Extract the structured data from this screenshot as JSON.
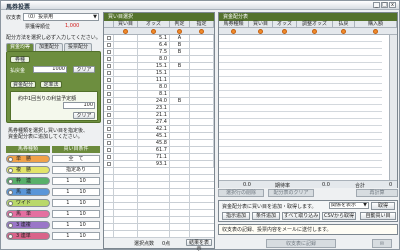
{
  "window": {
    "title": "馬券投票",
    "min_label": "_",
    "max_label": "□",
    "close_label": "x"
  },
  "left": {
    "race_label": "収支表",
    "race_value": "（0）投票用",
    "sub_label": "票獲得順位",
    "sub_value": "1,000",
    "instruction": "配分方法を選択し必ず入力してください。",
    "tabs": [
      "資金均等",
      "加重配分",
      "投票配分"
    ],
    "green": {
      "bet_type_label": "券種",
      "amount_label": "払戻金",
      "amount_value": "1000",
      "clear_label": "クリア",
      "mode_label": "資金配分",
      "mode_value": "定率法",
      "range_text": "約中1回当りの利益予定額",
      "range_value": "100",
      "clear2_label": "クリア"
    },
    "note_lines": [
      "馬券種類を選択し買い目を指定後、",
      "資金配分表に追加してください。"
    ],
    "table_head": [
      "馬券種類",
      "買い目条件"
    ],
    "bets": [
      {
        "name": "単　勝",
        "cond": "全　て",
        "color": "#f1a24a"
      },
      {
        "name": "複　勝",
        "cond": "指定あり",
        "color": "#e2e46a"
      },
      {
        "name": "枠　連",
        "cond": "1　　10",
        "color": "#58b06a"
      },
      {
        "name": "馬　連",
        "cond": "1　　10",
        "color": "#5a96d8"
      },
      {
        "name": "ワイド",
        "cond": "1　　10",
        "color": "#b9d86a"
      },
      {
        "name": "馬　単",
        "cond": "1　　10",
        "color": "#e46fa0"
      },
      {
        "name": "3 連複",
        "cond": "1　　10",
        "color": "#9a76c8"
      },
      {
        "name": "3 連単",
        "cond": "1　　10",
        "color": "#d9648a"
      }
    ]
  },
  "middle": {
    "header": "買い目選択",
    "columns": [
      "買い目",
      "オッズ",
      "判定",
      "指定"
    ],
    "rows": [
      {
        "odds": "5.1",
        "judge": "A",
        "spec": ""
      },
      {
        "odds": "6.4",
        "judge": "B",
        "spec": ""
      },
      {
        "odds": "7.5",
        "judge": "B",
        "spec": ""
      },
      {
        "odds": "8.0",
        "judge": "",
        "spec": ""
      },
      {
        "odds": "15.1",
        "judge": "B",
        "spec": ""
      },
      {
        "odds": "15.1",
        "judge": "",
        "spec": ""
      },
      {
        "odds": "11.1",
        "judge": "",
        "spec": ""
      },
      {
        "odds": "8.0",
        "judge": "",
        "spec": ""
      },
      {
        "odds": "8.1",
        "judge": "",
        "spec": ""
      },
      {
        "odds": "24.0",
        "judge": "B",
        "spec": ""
      },
      {
        "odds": "23.1",
        "judge": "",
        "spec": ""
      },
      {
        "odds": "21.1",
        "judge": "",
        "spec": ""
      },
      {
        "odds": "27.4",
        "judge": "",
        "spec": ""
      },
      {
        "odds": "42.1",
        "judge": "",
        "spec": ""
      },
      {
        "odds": "45.1",
        "judge": "",
        "spec": ""
      },
      {
        "odds": "45.8",
        "judge": "",
        "spec": ""
      },
      {
        "odds": "61.7",
        "judge": "",
        "spec": ""
      },
      {
        "odds": "71.1",
        "judge": "",
        "spec": ""
      },
      {
        "odds": "93.1",
        "judge": "",
        "spec": ""
      }
    ],
    "footer_label": "選択点数",
    "footer_value": "0点",
    "footer_button": "結果を表示"
  },
  "right": {
    "header": "資金配分表",
    "columns": [
      "馬券種類",
      "買い目",
      "オッズ",
      "調整オッズ",
      "払戻",
      "購入額"
    ],
    "totals": {
      "r1": "0.0",
      "r1_label": "期待率",
      "r2": "0.0",
      "r2_label": "合計",
      "r3": "0"
    },
    "disabled_buttons": [
      "選択行の削除",
      "配分表のクリア",
      "再計算"
    ],
    "buy_note": "資金配分表に買い目を追加・取得します。",
    "buy_option": "関係を表示",
    "buy_option2": "取得",
    "buy_buttons": [
      "指示追加",
      "条件追加",
      "すべて取り込み",
      "CSVから取得",
      "自動買い目"
    ],
    "message": "収支表の記録、投票内容をメールに送付します。",
    "foot_label": "収支表に記録",
    "foot_btn": "✉"
  }
}
